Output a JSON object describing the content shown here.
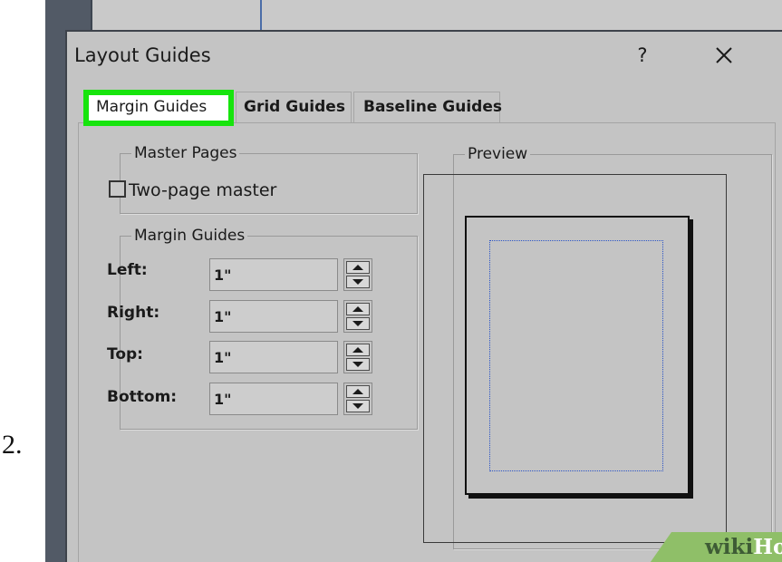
{
  "step_number": "2.",
  "dialog": {
    "title": "Layout Guides",
    "help_label": "?"
  },
  "tabs": [
    {
      "label": "Margin Guides",
      "selected": true,
      "highlighted": true
    },
    {
      "label": "Grid Guides",
      "selected": false
    },
    {
      "label": "Baseline Guides",
      "selected": false
    }
  ],
  "master_pages": {
    "group_label": "Master Pages",
    "two_page_master": {
      "label": "Two-page master",
      "checked": false
    }
  },
  "margin_guides": {
    "group_label": "Margin Guides",
    "fields": [
      {
        "label": "Left:",
        "value": "1\""
      },
      {
        "label": "Right:",
        "value": "1\""
      },
      {
        "label": "Top:",
        "value": "1\""
      },
      {
        "label": "Bottom:",
        "value": "1\""
      }
    ]
  },
  "preview": {
    "group_label": "Preview"
  },
  "watermark": {
    "wiki": "wiki",
    "how": "How"
  },
  "colors": {
    "highlight": "#17e40d",
    "dialog_bg": "#c4c4c4",
    "margin_line": "#2c55c6",
    "watermark_bg": "#8fbf68"
  },
  "icons": [
    "close-icon",
    "spin-up-arrow-icon",
    "spin-down-arrow-icon"
  ]
}
